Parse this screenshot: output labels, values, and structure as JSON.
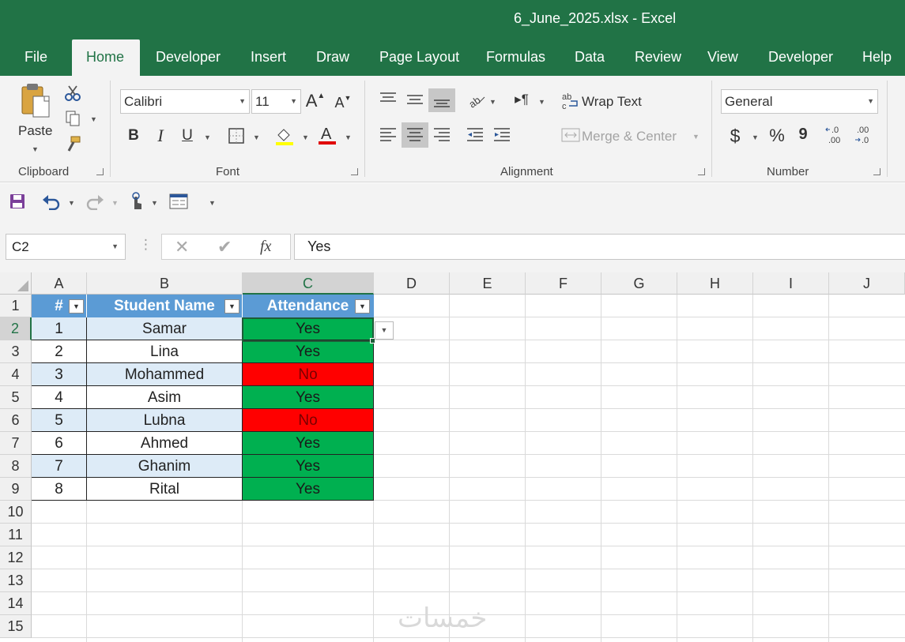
{
  "window": {
    "title": "6_June_2025.xlsx  -  Excel"
  },
  "tabs": [
    "File",
    "Home",
    "Developer",
    "Insert",
    "Draw",
    "Page Layout",
    "Formulas",
    "Data",
    "Review",
    "View",
    "Developer",
    "Help"
  ],
  "ribbon": {
    "clipboard": {
      "paste_label": "Paste",
      "group_label": "Clipboard"
    },
    "font": {
      "font_name": "Calibri",
      "font_size": "11",
      "group_label": "Font",
      "bold": "B",
      "italic": "I",
      "underline": "U"
    },
    "alignment": {
      "wrap_text": "Wrap Text",
      "merge_center": "Merge & Center",
      "group_label": "Alignment"
    },
    "number": {
      "format": "General",
      "currency": "$",
      "percent": "%",
      "comma": "9",
      "group_label": "Number"
    }
  },
  "formula_bar": {
    "name_box": "C2",
    "fx": "fx",
    "value": "Yes"
  },
  "columns": [
    "A",
    "B",
    "C",
    "D",
    "E",
    "F",
    "G",
    "H",
    "I",
    "J"
  ],
  "rows": [
    "1",
    "2",
    "3",
    "4",
    "5",
    "6",
    "7",
    "8",
    "9",
    "10",
    "11",
    "12",
    "13",
    "14",
    "15"
  ],
  "table": {
    "headers": [
      "#",
      "Student Name",
      "Attendance"
    ],
    "records": [
      {
        "num": "1",
        "name": "Samar",
        "attendance": "Yes"
      },
      {
        "num": "2",
        "name": "Lina",
        "attendance": "Yes"
      },
      {
        "num": "3",
        "name": "Mohammed",
        "attendance": "No"
      },
      {
        "num": "4",
        "name": "Asim",
        "attendance": "Yes"
      },
      {
        "num": "5",
        "name": "Lubna",
        "attendance": "No"
      },
      {
        "num": "6",
        "name": "Ahmed",
        "attendance": "Yes"
      },
      {
        "num": "7",
        "name": "Ghanim",
        "attendance": "Yes"
      },
      {
        "num": "8",
        "name": "Rital",
        "attendance": "Yes"
      }
    ]
  },
  "colors": {
    "excel_green": "#217346",
    "header_blue": "#5b9bd5",
    "band_blue": "#ddebf7",
    "yes_green": "#00b050",
    "no_red": "#ff0000"
  },
  "watermark": "خمسات"
}
